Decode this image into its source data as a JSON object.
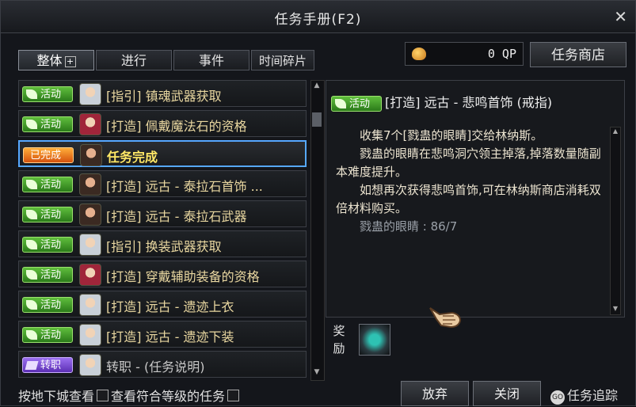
{
  "window": {
    "title": "任务手册(F2)"
  },
  "tabs": [
    {
      "label": "整体",
      "active": true
    },
    {
      "label": "进行",
      "active": false
    },
    {
      "label": "事件",
      "active": false
    },
    {
      "label": "时间碎片",
      "active": false
    }
  ],
  "currency": {
    "value": "0 QP",
    "icon": "coin-icon"
  },
  "shop": {
    "label": "任务商店"
  },
  "quests": [
    {
      "badge": "活动",
      "badge_type": "activity",
      "avatar": "silver",
      "title": "[指引] 镇魂武器获取"
    },
    {
      "badge": "活动",
      "badge_type": "activity",
      "avatar": "red",
      "title": "[打造] 佩戴魔法石的资格"
    },
    {
      "badge": "已完成",
      "badge_type": "done",
      "avatar": "dark",
      "title": "任务完成",
      "selected": true
    },
    {
      "badge": "活动",
      "badge_type": "activity",
      "avatar": "dark",
      "title": "[打造] 远古 - 泰拉石首饰 ..."
    },
    {
      "badge": "活动",
      "badge_type": "activity",
      "avatar": "dark",
      "title": "[打造] 远古 - 泰拉石武器"
    },
    {
      "badge": "活动",
      "badge_type": "activity",
      "avatar": "silver",
      "title": "[指引] 换装武器获取"
    },
    {
      "badge": "活动",
      "badge_type": "activity",
      "avatar": "red",
      "title": "[打造] 穿戴辅助装备的资格"
    },
    {
      "badge": "活动",
      "badge_type": "activity",
      "avatar": "silver",
      "title": "[打造] 远古 - 遗迹上衣"
    },
    {
      "badge": "活动",
      "badge_type": "activity",
      "avatar": "silver",
      "title": "[打造] 远古 - 遗迹下装"
    },
    {
      "badge": "转职",
      "badge_type": "job",
      "avatar": "silver",
      "title": "转职 - (任务说明)"
    }
  ],
  "detail": {
    "badge": "活动",
    "title": "[打造] 远古 - 悲鸣首饰 (戒指)",
    "paragraphs": [
      "收集7个[戮蛊的眼睛]交给林纳斯。",
      "戮蛊的眼睛在悲鸣洞穴领主掉落,掉落数量随副本难度提升。",
      "如想再次获得悲鸣首饰,可在林纳斯商店消耗双倍材料购买。"
    ],
    "progress": "戮蛊的眼睛 : 86/7"
  },
  "reward": {
    "label": "奖励"
  },
  "footer": {
    "dungeon_label": "按地下城查看",
    "level_filter_label": "查看符合等级的任务",
    "abandon_label": "放弃",
    "close_label": "关闭",
    "trace_label": "任务追踪",
    "trace_badge": "GO"
  }
}
